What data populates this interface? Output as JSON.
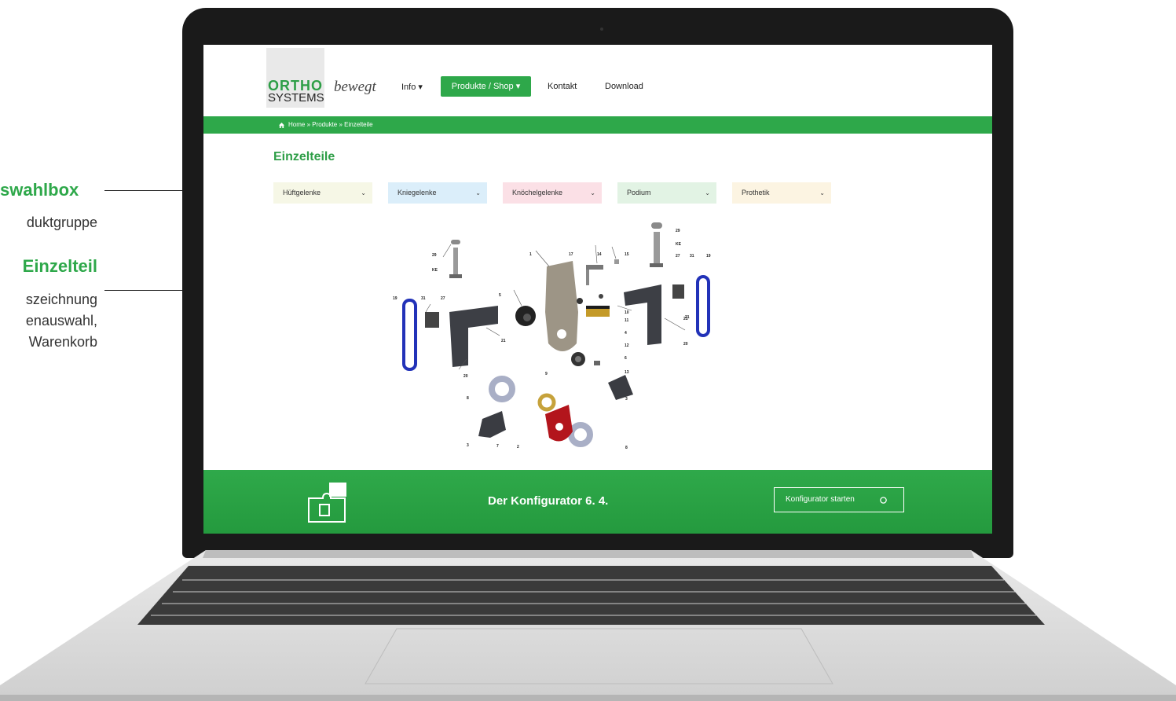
{
  "annotations": [
    {
      "title": "swahlbox",
      "lines": [
        "duktgruppe"
      ]
    },
    {
      "title": "Einzelteil",
      "lines": [
        "szeichnung",
        "enauswahl,",
        "Warenkorb"
      ]
    }
  ],
  "logo": {
    "ortho": "ORTHO",
    "systems": "SYSTEMS",
    "tagline": "bewegt"
  },
  "nav": {
    "info": "Info ▾",
    "products": "Produkte / Shop ▾",
    "contact": "Kontakt",
    "download": "Download"
  },
  "breadcrumb": "Home » Produkte » Einzelteile",
  "page_title": "Einzelteile",
  "selects": [
    {
      "label": "Hüftgelenke",
      "color": "#f6f7e6"
    },
    {
      "label": "Kniegelenke",
      "color": "#dbeefa"
    },
    {
      "label": "Knöchelgelenke",
      "color": "#fbe0e6"
    },
    {
      "label": "Podium",
      "color": "#e2f3e4"
    },
    {
      "label": "Prothetik",
      "color": "#fcf4e2"
    }
  ],
  "chevron": "⌄",
  "diagram_labels": [
    "29",
    "KE",
    "31",
    "19",
    "27",
    "5",
    "1",
    "17",
    "14",
    "15",
    "21",
    "21",
    "20",
    "10",
    "11",
    "4",
    "12",
    "9",
    "6",
    "13",
    "7",
    "3",
    "2",
    "8",
    "8",
    "3",
    "29",
    "KE",
    "27",
    "31",
    "19",
    "20",
    "21"
  ],
  "footer": {
    "title": "Der Konfigurator 6. 4.",
    "button": "Konfigurator starten"
  },
  "colors": {
    "accent": "#2ea84a",
    "text": "#222222"
  }
}
